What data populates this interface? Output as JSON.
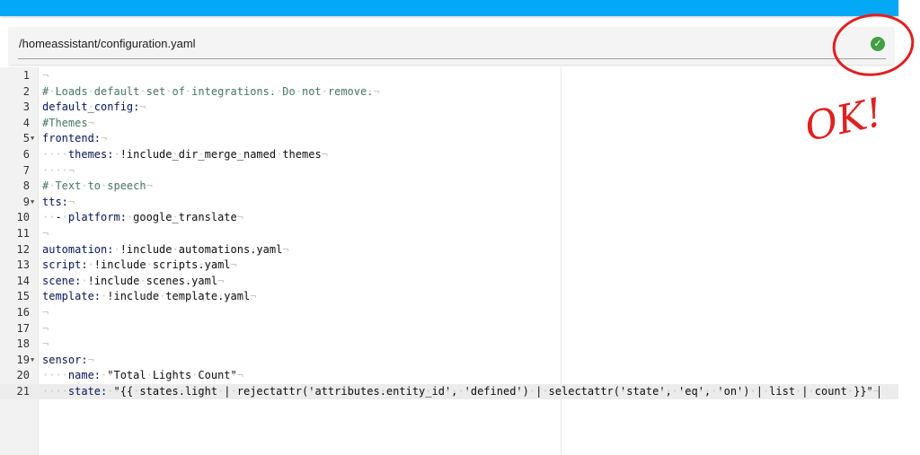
{
  "header": {
    "file_path": "/homeassistant/configuration.yaml",
    "status_icon": "check-circle-icon",
    "status_color": "#43a047"
  },
  "editor": {
    "lines": [
      {
        "n": "1",
        "text": ""
      },
      {
        "n": "2",
        "text": "# Loads default set of integrations. Do not remove."
      },
      {
        "n": "3",
        "text": "default_config:"
      },
      {
        "n": "4",
        "text": "#Themes"
      },
      {
        "n": "5",
        "text": "frontend:",
        "fold": true
      },
      {
        "n": "6",
        "text": "    themes: !include_dir_merge_named themes"
      },
      {
        "n": "7",
        "text": "    "
      },
      {
        "n": "8",
        "text": "# Text to speech"
      },
      {
        "n": "9",
        "text": "tts:",
        "fold": true
      },
      {
        "n": "10",
        "text": "  - platform: google_translate"
      },
      {
        "n": "11",
        "text": ""
      },
      {
        "n": "12",
        "text": "automation: !include automations.yaml"
      },
      {
        "n": "13",
        "text": "script: !include scripts.yaml"
      },
      {
        "n": "14",
        "text": "scene: !include scenes.yaml"
      },
      {
        "n": "15",
        "text": "template: !include template.yaml"
      },
      {
        "n": "16",
        "text": ""
      },
      {
        "n": "17",
        "text": ""
      },
      {
        "n": "18",
        "text": ""
      },
      {
        "n": "19",
        "text": "sensor:",
        "fold": true
      },
      {
        "n": "20",
        "text": "    name: \"Total Lights Count\""
      },
      {
        "n": "21",
        "text": "    state: \"{{ states.light | rejectattr('attributes.entity_id', 'defined') | selectattr('state', 'eq', 'on') | list | count }}\"",
        "active": true
      }
    ]
  },
  "annotation": {
    "handwritten_text": "OK!",
    "color": "#e02020"
  }
}
